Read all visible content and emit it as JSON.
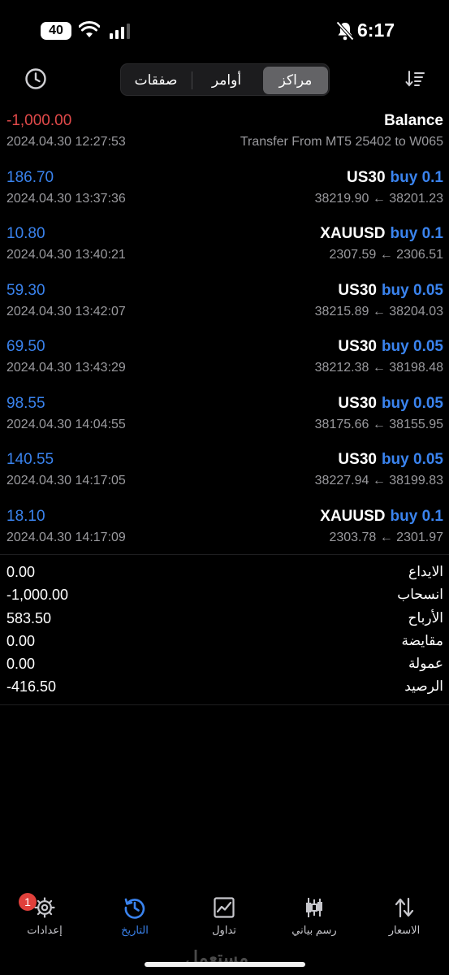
{
  "status_bar": {
    "battery": "40",
    "time": "6:17"
  },
  "header": {
    "tabs": [
      {
        "label": "مراكز",
        "active": true
      },
      {
        "label": "أوامر",
        "active": false
      },
      {
        "label": "صفقات",
        "active": false
      }
    ]
  },
  "history": [
    {
      "amount": "-1,000.00",
      "time": "2024.04.30 12:27:53",
      "symbol": "Balance",
      "side": "",
      "detail": "Transfer From MT5 25402 to W065",
      "negative": true
    },
    {
      "amount": "186.70",
      "time": "2024.04.30 13:37:36",
      "symbol": "US30",
      "side": "buy 0.1",
      "detail": "38219.90 ← 38201.23",
      "negative": false
    },
    {
      "amount": "10.80",
      "time": "2024.04.30 13:40:21",
      "symbol": "XAUUSD",
      "side": "buy 0.1",
      "detail": "2307.59 ← 2306.51",
      "negative": false
    },
    {
      "amount": "59.30",
      "time": "2024.04.30 13:42:07",
      "symbol": "US30",
      "side": "buy 0.05",
      "detail": "38215.89 ← 38204.03",
      "negative": false
    },
    {
      "amount": "69.50",
      "time": "2024.04.30 13:43:29",
      "symbol": "US30",
      "side": "buy 0.05",
      "detail": "38212.38 ← 38198.48",
      "negative": false
    },
    {
      "amount": "98.55",
      "time": "2024.04.30 14:04:55",
      "symbol": "US30",
      "side": "buy 0.05",
      "detail": "38175.66 ← 38155.95",
      "negative": false
    },
    {
      "amount": "140.55",
      "time": "2024.04.30 14:17:05",
      "symbol": "US30",
      "side": "buy 0.05",
      "detail": "38227.94 ← 38199.83",
      "negative": false
    },
    {
      "amount": "18.10",
      "time": "2024.04.30 14:17:09",
      "symbol": "XAUUSD",
      "side": "buy 0.1",
      "detail": "2303.78 ← 2301.97",
      "negative": false
    }
  ],
  "summary": [
    {
      "label": "الايداع",
      "value": "0.00"
    },
    {
      "label": "انسحاب",
      "value": "-1,000.00"
    },
    {
      "label": "الأرباح",
      "value": "583.50"
    },
    {
      "label": "مقايضة",
      "value": "0.00"
    },
    {
      "label": "عمولة",
      "value": "0.00"
    },
    {
      "label": "الرصيد",
      "value": "-416.50"
    }
  ],
  "tabbar": {
    "badge": "1",
    "tabs": [
      {
        "label": "إعدادات",
        "icon": "gear-icon",
        "active": false
      },
      {
        "label": "التاريخ",
        "icon": "history-icon",
        "active": true
      },
      {
        "label": "تداول",
        "icon": "trade-chart-icon",
        "active": false
      },
      {
        "label": "رسم بياني",
        "icon": "candlestick-icon",
        "active": false
      },
      {
        "label": "الاسعار",
        "icon": "quotes-arrows-icon",
        "active": false
      }
    ]
  },
  "watermark": "مستعمل",
  "colors": {
    "accent": "#3a83ee",
    "negative": "#e24a4a",
    "background": "#000000",
    "badge": "#e0403b"
  }
}
